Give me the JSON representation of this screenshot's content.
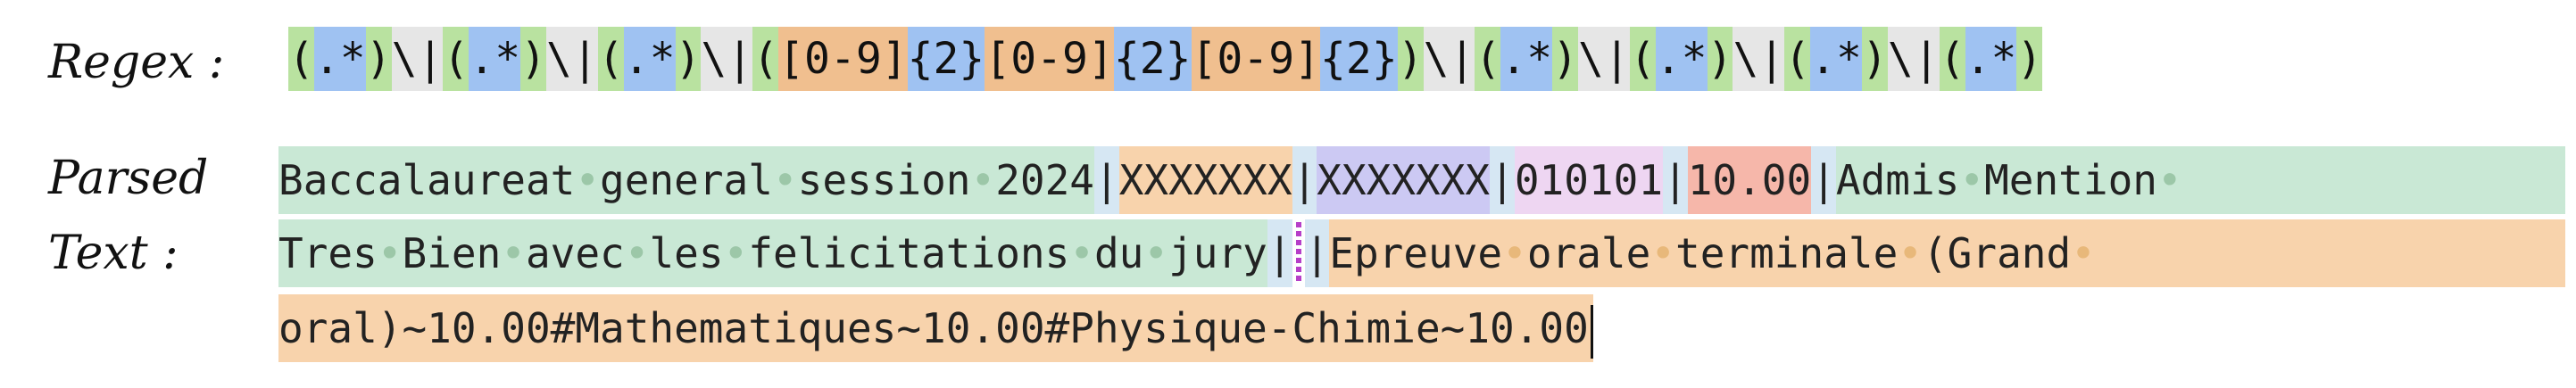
{
  "labels": {
    "regex": "Regex :",
    "parsed_line1": "Parsed",
    "parsed_line2": "Text :"
  },
  "regex_tokens": [
    {
      "t": "(",
      "c": "g"
    },
    {
      "t": ".*",
      "c": "b"
    },
    {
      "t": ")",
      "c": "g"
    },
    {
      "t": "\\|",
      "c": "s"
    },
    {
      "t": "(",
      "c": "g"
    },
    {
      "t": ".*",
      "c": "b"
    },
    {
      "t": ")",
      "c": "g"
    },
    {
      "t": "\\|",
      "c": "s"
    },
    {
      "t": "(",
      "c": "g"
    },
    {
      "t": ".*",
      "c": "b"
    },
    {
      "t": ")",
      "c": "g"
    },
    {
      "t": "\\|",
      "c": "s"
    },
    {
      "t": "(",
      "c": "g"
    },
    {
      "t": "[0-9]",
      "c": "o"
    },
    {
      "t": "{2}",
      "c": "b"
    },
    {
      "t": "[0-9]",
      "c": "o"
    },
    {
      "t": "{2}",
      "c": "b"
    },
    {
      "t": "[0-9]",
      "c": "o"
    },
    {
      "t": "{2}",
      "c": "b"
    },
    {
      "t": ")",
      "c": "g"
    },
    {
      "t": "\\|",
      "c": "s"
    },
    {
      "t": "(",
      "c": "g"
    },
    {
      "t": ".*",
      "c": "b"
    },
    {
      "t": ")",
      "c": "g"
    },
    {
      "t": "\\|",
      "c": "s"
    },
    {
      "t": "(",
      "c": "g"
    },
    {
      "t": ".*",
      "c": "b"
    },
    {
      "t": ")",
      "c": "g"
    },
    {
      "t": "\\|",
      "c": "s"
    },
    {
      "t": "(",
      "c": "g"
    },
    {
      "t": ".*",
      "c": "b"
    },
    {
      "t": ")",
      "c": "g"
    },
    {
      "t": "\\|",
      "c": "s"
    },
    {
      "t": "(",
      "c": "g"
    },
    {
      "t": ".*",
      "c": "b"
    },
    {
      "t": ")",
      "c": "g"
    }
  ],
  "parsed": {
    "line1": [
      {
        "t": "Baccalaureat•general•session•2024",
        "c": "green"
      },
      {
        "t": "|",
        "c": "sep"
      },
      {
        "t": "XXXXXXX",
        "c": "orange"
      },
      {
        "t": "|",
        "c": "sep"
      },
      {
        "t": "XXXXXXX",
        "c": "lav"
      },
      {
        "t": "|",
        "c": "sep"
      },
      {
        "t": "010101",
        "c": "pink"
      },
      {
        "t": "|",
        "c": "sep"
      },
      {
        "t": "10.00",
        "c": "salmon"
      },
      {
        "t": "|",
        "c": "sep"
      },
      {
        "t": "Admis•Mention•",
        "c": "green",
        "grow": true
      }
    ],
    "line2": [
      {
        "t": "Tres•Bien•avec•les•felicitations•du•jury",
        "c": "green"
      },
      {
        "t": "|",
        "c": "sep"
      },
      {
        "marker": true
      },
      {
        "t": "|",
        "c": "sep"
      },
      {
        "t": "Epreuve•orale•terminale•(Grand•",
        "c": "orange",
        "grow": true
      }
    ],
    "line3": [
      {
        "t": "oral)~10.00#Mathematiques~10.00#Physique-Chimie~10.00",
        "c": "orange",
        "cursor": true
      }
    ]
  }
}
